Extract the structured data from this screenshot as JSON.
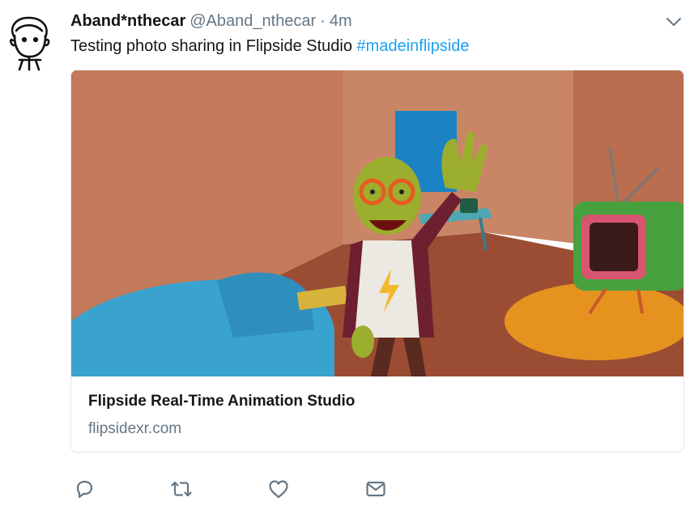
{
  "tweet": {
    "display_name": "Aband*nthecar",
    "handle": "@Aband_nthecar",
    "separator": "·",
    "time": "4m",
    "text": "Testing photo sharing in Flipside Studio ",
    "hashtag": "#madeinflipside"
  },
  "card": {
    "title": "Flipside Real-Time Animation Studio",
    "domain": "flipsidexr.com"
  },
  "colors": {
    "link": "#1da1f2",
    "secondary_text": "#657786",
    "icon": "#657786"
  },
  "icons": [
    "user-avatar",
    "chevron-down-icon",
    "reply-icon",
    "retweet-icon",
    "like-icon",
    "message-icon"
  ]
}
